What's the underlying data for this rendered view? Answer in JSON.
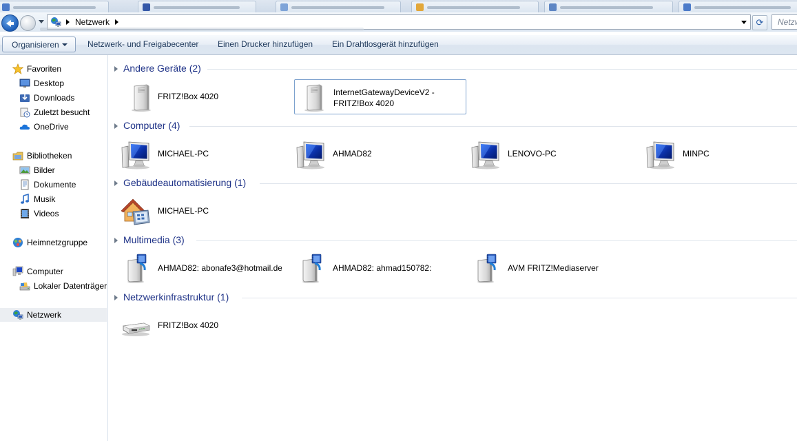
{
  "browser_tabs": [
    {
      "color": "#4c7bc9"
    },
    {
      "color": "#3558a8"
    },
    {
      "color": "#7fa4d8"
    },
    {
      "color": "#e2a73a"
    },
    {
      "color": "#5e86c4"
    },
    {
      "color": "#4c7bc9"
    }
  ],
  "address": {
    "location": "Netzwerk",
    "search_placeholder": "Netzw"
  },
  "toolbar": {
    "organize": "Organisieren",
    "network_center": "Netzwerk- und Freigabecenter",
    "add_printer": "Einen Drucker hinzufügen",
    "add_wireless": "Ein Drahtlosgerät hinzufügen"
  },
  "nav": {
    "favorites": "Favoriten",
    "desktop": "Desktop",
    "downloads": "Downloads",
    "recent": "Zuletzt besucht",
    "onedrive": "OneDrive",
    "libraries": "Bibliotheken",
    "pictures": "Bilder",
    "documents": "Dokumente",
    "music": "Musik",
    "videos": "Videos",
    "homegroup": "Heimnetzgruppe",
    "computer": "Computer",
    "local_disk": "Lokaler Datenträger",
    "network": "Netzwerk"
  },
  "groups": {
    "other": {
      "title": "Andere Geräte (2)",
      "items": [
        "FRITZ!Box 4020",
        "InternetGatewayDeviceV2 - FRITZ!Box 4020"
      ]
    },
    "computer": {
      "title": "Computer (4)",
      "items": [
        "MICHAEL-PC",
        "AHMAD82",
        "LENOVO-PC",
        "MINPC"
      ]
    },
    "building": {
      "title": "Gebäudeautomatisierung (1)",
      "items": [
        "MICHAEL-PC"
      ]
    },
    "media": {
      "title": "Multimedia (3)",
      "items": [
        "AHMAD82: abonafe3@hotmail.de:",
        "AHMAD82: ahmad150782:",
        "AVM FRITZ!Mediaserver"
      ]
    },
    "infra": {
      "title": "Netzwerkinfrastruktur (1)",
      "items": [
        "FRITZ!Box 4020"
      ]
    }
  }
}
